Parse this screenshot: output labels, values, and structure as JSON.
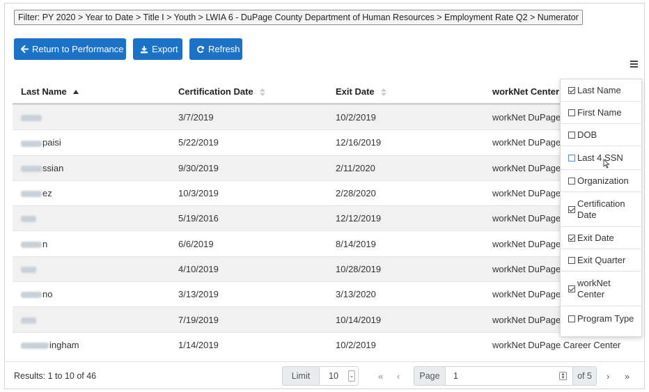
{
  "filter": {
    "text": "Filter: PY 2020 > Year to Date > Title I > Youth > LWIA 6 - DuPage County Department of Human Resources > Employment Rate Q2 > Numerator"
  },
  "toolbar": {
    "return_label": "Return to Performance",
    "export_label": "Export",
    "refresh_label": "Refresh",
    "color": "#1a73c9"
  },
  "table": {
    "headers": [
      "Last Name",
      "Certification Date",
      "Exit Date",
      "workNet Center"
    ],
    "sorted_column": "Last Name",
    "sort_direction": "ascending",
    "rows": [
      {
        "last_name": "",
        "cert": "3/7/2019",
        "exit": "10/2/2019",
        "center": "workNet DuPage"
      },
      {
        "last_name": "paisi",
        "cert": "5/22/2019",
        "exit": "12/16/2019",
        "center": "workNet DuPage"
      },
      {
        "last_name": "ssian",
        "cert": "9/30/2019",
        "exit": "2/11/2020",
        "center": "workNet DuPage"
      },
      {
        "last_name": "ez",
        "cert": "10/3/2019",
        "exit": "2/28/2020",
        "center": "workNet DuPage"
      },
      {
        "last_name": "",
        "cert": "5/19/2016",
        "exit": "12/12/2019",
        "center": "workNet DuPage"
      },
      {
        "last_name": "n",
        "cert": "6/6/2019",
        "exit": "8/14/2019",
        "center": "workNet DuPage"
      },
      {
        "last_name": "",
        "cert": "4/10/2019",
        "exit": "10/28/2019",
        "center": "workNet DuPage"
      },
      {
        "last_name": "no",
        "cert": "3/13/2019",
        "exit": "3/13/2020",
        "center": "workNet DuPage"
      },
      {
        "last_name": "",
        "cert": "7/19/2019",
        "exit": "10/14/2019",
        "center": "workNet DuPage"
      },
      {
        "last_name": "ingham",
        "cert": "1/14/2019",
        "exit": "10/2/2019",
        "center": "workNet DuPage Career Center"
      }
    ]
  },
  "column_menu": {
    "items": [
      {
        "label": "Last Name",
        "checked": true
      },
      {
        "label": "First Name",
        "checked": false
      },
      {
        "label": "DOB",
        "checked": false
      },
      {
        "label": "Last 4 SSN",
        "checked": false
      },
      {
        "label": "Organization",
        "checked": false
      },
      {
        "label": "Certification Date",
        "checked": true
      },
      {
        "label": "Exit Date",
        "checked": true
      },
      {
        "label": "Exit Quarter",
        "checked": false
      },
      {
        "label": "workNet Center",
        "checked": true
      },
      {
        "label": "Program Type",
        "checked": false
      }
    ]
  },
  "footer": {
    "results": "Results: 1 to 10 of 46",
    "limit_label": "Limit",
    "limit_value": "10",
    "first": "«",
    "prev": "‹",
    "page_label": "Page",
    "page_value": "1",
    "of_label": "of 5",
    "next": "›",
    "last": "»"
  }
}
